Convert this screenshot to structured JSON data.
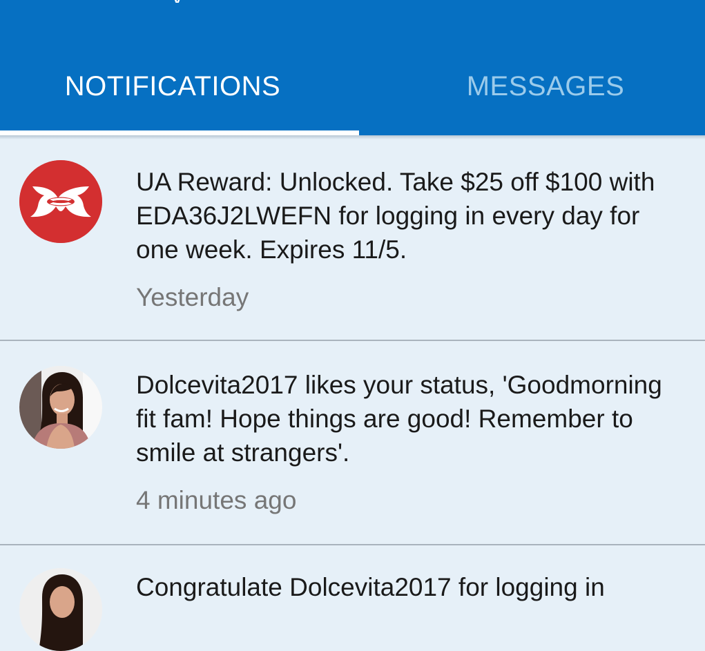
{
  "header": {
    "title_fragment": "y"
  },
  "tabs": [
    {
      "label": "NOTIFICATIONS",
      "active": true
    },
    {
      "label": "MESSAGES",
      "active": false
    }
  ],
  "colors": {
    "header_bg": "#0670c2",
    "active_tab": "#ffffff",
    "inactive_tab": "#9bcbeb",
    "list_bg": "#e6f0f8",
    "brand_red": "#d32f30"
  },
  "notifications": [
    {
      "avatar": "under-armour-logo",
      "text": "UA Reward: Unlocked. Take $25 off $100 with EDA36J2LWEFN for logging in every day for one week. Expires 11/5.",
      "time": "Yesterday"
    },
    {
      "avatar": "user-photo-avatar",
      "text": "Dolcevita2017 likes your status, 'Goodmorning fit fam! Hope things are good! Remember to smile at strangers'.",
      "time": "4 minutes ago"
    },
    {
      "avatar": "user-photo-avatar",
      "text": "Congratulate Dolcevita2017 for logging in",
      "time": ""
    }
  ]
}
